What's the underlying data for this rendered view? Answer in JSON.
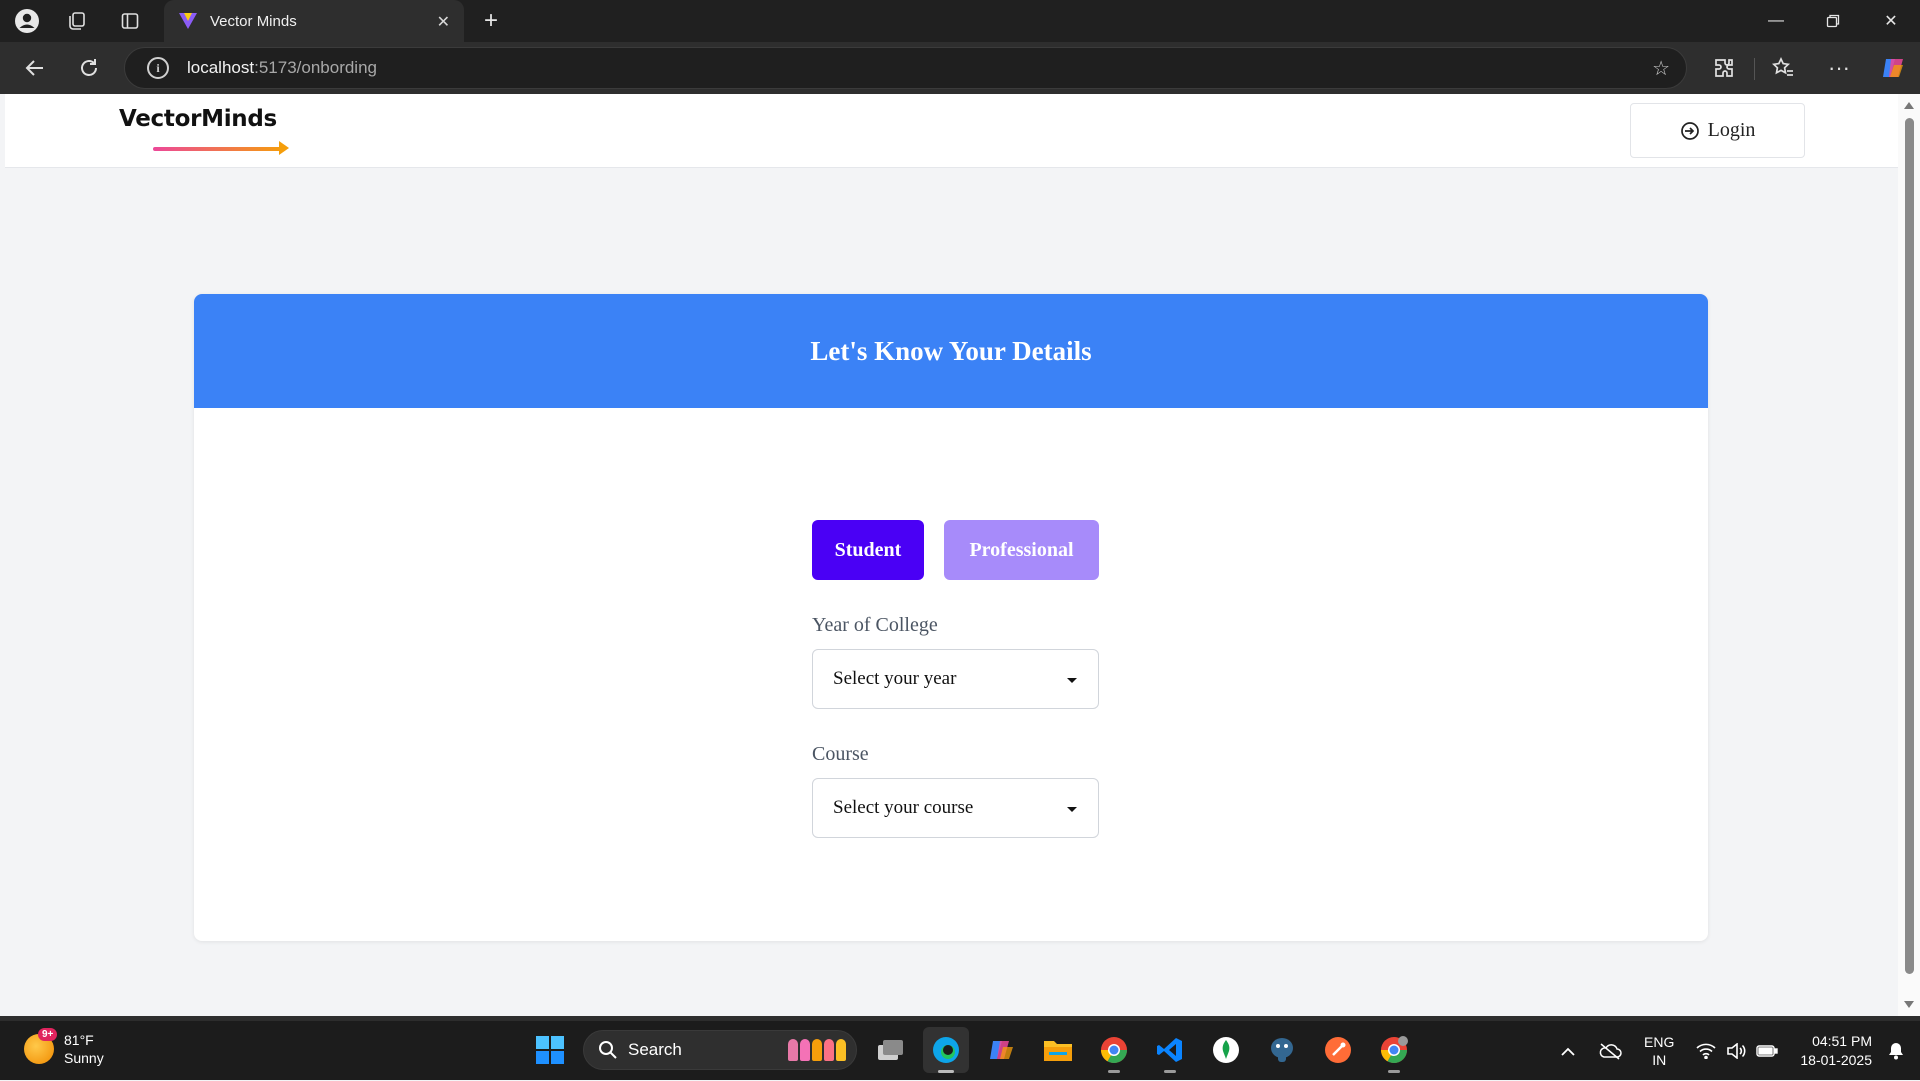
{
  "browser": {
    "tab_title": "Vector Minds",
    "url_host": "localhost",
    "url_path": ":5173/onbording"
  },
  "app": {
    "logo_text": "VectorMinds",
    "login_label": "Login"
  },
  "card": {
    "title": "Let's Know Your Details",
    "roles": [
      "Student",
      "Professional"
    ],
    "selected_role": "Student",
    "year_label": "Year of College",
    "year_placeholder": "Select your year",
    "course_label": "Course",
    "course_placeholder": "Select your course"
  },
  "taskbar": {
    "weather_temp": "81°F",
    "weather_desc": "Sunny",
    "weather_badge": "9+",
    "search_label": "Search",
    "lang_line1": "ENG",
    "lang_line2": "IN",
    "time": "04:51 PM",
    "date": "18-01-2025"
  },
  "colors": {
    "header_blue": "#3b82f6",
    "student_selected": "#4a00f5",
    "professional_unselected": "#a78bfa"
  }
}
